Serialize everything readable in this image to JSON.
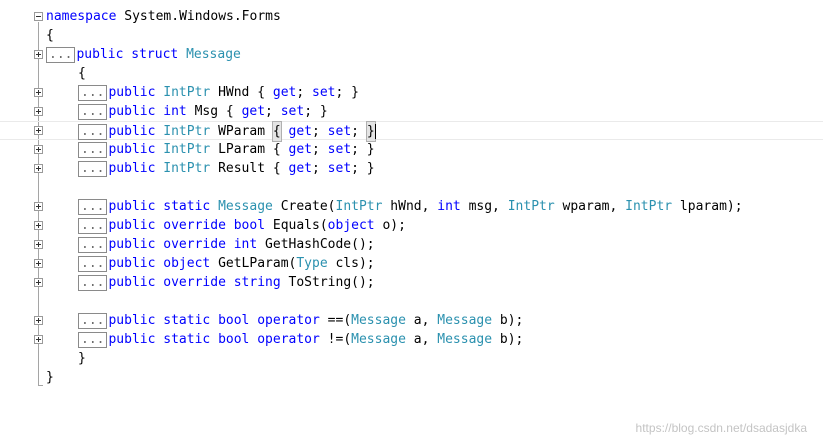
{
  "colors": {
    "keyword": "#0000ff",
    "type": "#2b91af",
    "plain": "#000000",
    "collapsed_marker": "#6d6d6d",
    "watermark": "#c4c4c4"
  },
  "ellipsis_label": "...",
  "watermark": "https://blog.csdn.net/dsadasjdka",
  "lines": [
    {
      "toggle": "expanded",
      "ellipsis": false,
      "current": false,
      "tokens": [
        {
          "t": "namespace",
          "k": "kw"
        },
        {
          "t": " System.Windows.Forms",
          "k": "pl"
        }
      ]
    },
    {
      "toggle": "none",
      "ellipsis": false,
      "current": false,
      "tokens": [
        {
          "t": "{",
          "k": "pl"
        }
      ]
    },
    {
      "toggle": "collapsed",
      "ellipsis": true,
      "current": false,
      "tokens": [
        {
          "t": "public",
          "k": "kw"
        },
        {
          "t": " ",
          "k": "pl"
        },
        {
          "t": "struct",
          "k": "kw"
        },
        {
          "t": " ",
          "k": "pl"
        },
        {
          "t": "Message",
          "k": "ty"
        }
      ]
    },
    {
      "toggle": "none",
      "ellipsis": false,
      "current": false,
      "tokens": [
        {
          "t": "{",
          "k": "pl"
        }
      ]
    },
    {
      "toggle": "collapsed",
      "ellipsis": true,
      "current": false,
      "tokens": [
        {
          "t": "public",
          "k": "kw"
        },
        {
          "t": " ",
          "k": "pl"
        },
        {
          "t": "IntPtr",
          "k": "ty"
        },
        {
          "t": " HWnd { ",
          "k": "pl"
        },
        {
          "t": "get",
          "k": "kw"
        },
        {
          "t": "; ",
          "k": "pl"
        },
        {
          "t": "set",
          "k": "kw"
        },
        {
          "t": "; }",
          "k": "pl"
        }
      ]
    },
    {
      "toggle": "collapsed",
      "ellipsis": true,
      "current": false,
      "tokens": [
        {
          "t": "public",
          "k": "kw"
        },
        {
          "t": " ",
          "k": "pl"
        },
        {
          "t": "int",
          "k": "kw"
        },
        {
          "t": " Msg { ",
          "k": "pl"
        },
        {
          "t": "get",
          "k": "kw"
        },
        {
          "t": "; ",
          "k": "pl"
        },
        {
          "t": "set",
          "k": "kw"
        },
        {
          "t": "; }",
          "k": "pl"
        }
      ]
    },
    {
      "toggle": "collapsed",
      "ellipsis": true,
      "current": true,
      "tokens": [
        {
          "t": "public",
          "k": "kw"
        },
        {
          "t": " ",
          "k": "pl"
        },
        {
          "t": "IntPtr",
          "k": "ty"
        },
        {
          "t": " WParam ",
          "k": "pl"
        },
        {
          "t": "{",
          "k": "hl"
        },
        {
          "t": " ",
          "k": "pl"
        },
        {
          "t": "get",
          "k": "kw"
        },
        {
          "t": "; ",
          "k": "pl"
        },
        {
          "t": "set",
          "k": "kw"
        },
        {
          "t": "; ",
          "k": "pl"
        },
        {
          "t": "}",
          "k": "hl"
        },
        {
          "t": "",
          "k": "caret"
        }
      ]
    },
    {
      "toggle": "collapsed",
      "ellipsis": true,
      "current": false,
      "tokens": [
        {
          "t": "public",
          "k": "kw"
        },
        {
          "t": " ",
          "k": "pl"
        },
        {
          "t": "IntPtr",
          "k": "ty"
        },
        {
          "t": " LParam { ",
          "k": "pl"
        },
        {
          "t": "get",
          "k": "kw"
        },
        {
          "t": "; ",
          "k": "pl"
        },
        {
          "t": "set",
          "k": "kw"
        },
        {
          "t": "; }",
          "k": "pl"
        }
      ]
    },
    {
      "toggle": "collapsed",
      "ellipsis": true,
      "current": false,
      "tokens": [
        {
          "t": "public",
          "k": "kw"
        },
        {
          "t": " ",
          "k": "pl"
        },
        {
          "t": "IntPtr",
          "k": "ty"
        },
        {
          "t": " Result { ",
          "k": "pl"
        },
        {
          "t": "get",
          "k": "kw"
        },
        {
          "t": "; ",
          "k": "pl"
        },
        {
          "t": "set",
          "k": "kw"
        },
        {
          "t": "; }",
          "k": "pl"
        }
      ]
    },
    {
      "toggle": "none",
      "ellipsis": false,
      "current": false,
      "tokens": []
    },
    {
      "toggle": "collapsed",
      "ellipsis": true,
      "current": false,
      "tokens": [
        {
          "t": "public",
          "k": "kw"
        },
        {
          "t": " ",
          "k": "pl"
        },
        {
          "t": "static",
          "k": "kw"
        },
        {
          "t": " ",
          "k": "pl"
        },
        {
          "t": "Message",
          "k": "ty"
        },
        {
          "t": " Create(",
          "k": "pl"
        },
        {
          "t": "IntPtr",
          "k": "ty"
        },
        {
          "t": " hWnd, ",
          "k": "pl"
        },
        {
          "t": "int",
          "k": "kw"
        },
        {
          "t": " msg, ",
          "k": "pl"
        },
        {
          "t": "IntPtr",
          "k": "ty"
        },
        {
          "t": " wparam, ",
          "k": "pl"
        },
        {
          "t": "IntPtr",
          "k": "ty"
        },
        {
          "t": " lparam);",
          "k": "pl"
        }
      ]
    },
    {
      "toggle": "collapsed",
      "ellipsis": true,
      "current": false,
      "tokens": [
        {
          "t": "public",
          "k": "kw"
        },
        {
          "t": " ",
          "k": "pl"
        },
        {
          "t": "override",
          "k": "kw"
        },
        {
          "t": " ",
          "k": "pl"
        },
        {
          "t": "bool",
          "k": "kw"
        },
        {
          "t": " Equals(",
          "k": "pl"
        },
        {
          "t": "object",
          "k": "kw"
        },
        {
          "t": " o);",
          "k": "pl"
        }
      ]
    },
    {
      "toggle": "collapsed",
      "ellipsis": true,
      "current": false,
      "tokens": [
        {
          "t": "public",
          "k": "kw"
        },
        {
          "t": " ",
          "k": "pl"
        },
        {
          "t": "override",
          "k": "kw"
        },
        {
          "t": " ",
          "k": "pl"
        },
        {
          "t": "int",
          "k": "kw"
        },
        {
          "t": " GetHashCode();",
          "k": "pl"
        }
      ]
    },
    {
      "toggle": "collapsed",
      "ellipsis": true,
      "current": false,
      "tokens": [
        {
          "t": "public",
          "k": "kw"
        },
        {
          "t": " ",
          "k": "pl"
        },
        {
          "t": "object",
          "k": "kw"
        },
        {
          "t": " GetLParam(",
          "k": "pl"
        },
        {
          "t": "Type",
          "k": "ty"
        },
        {
          "t": " cls);",
          "k": "pl"
        }
      ]
    },
    {
      "toggle": "collapsed",
      "ellipsis": true,
      "current": false,
      "tokens": [
        {
          "t": "public",
          "k": "kw"
        },
        {
          "t": " ",
          "k": "pl"
        },
        {
          "t": "override",
          "k": "kw"
        },
        {
          "t": " ",
          "k": "pl"
        },
        {
          "t": "string",
          "k": "kw"
        },
        {
          "t": " ToString();",
          "k": "pl"
        }
      ]
    },
    {
      "toggle": "none",
      "ellipsis": false,
      "current": false,
      "tokens": []
    },
    {
      "toggle": "collapsed",
      "ellipsis": true,
      "current": false,
      "tokens": [
        {
          "t": "public",
          "k": "kw"
        },
        {
          "t": " ",
          "k": "pl"
        },
        {
          "t": "static",
          "k": "kw"
        },
        {
          "t": " ",
          "k": "pl"
        },
        {
          "t": "bool",
          "k": "kw"
        },
        {
          "t": " ",
          "k": "pl"
        },
        {
          "t": "operator",
          "k": "kw"
        },
        {
          "t": " ==(",
          "k": "pl"
        },
        {
          "t": "Message",
          "k": "ty"
        },
        {
          "t": " a, ",
          "k": "pl"
        },
        {
          "t": "Message",
          "k": "ty"
        },
        {
          "t": " b);",
          "k": "pl"
        }
      ]
    },
    {
      "toggle": "collapsed",
      "ellipsis": true,
      "current": false,
      "tokens": [
        {
          "t": "public",
          "k": "kw"
        },
        {
          "t": " ",
          "k": "pl"
        },
        {
          "t": "static",
          "k": "kw"
        },
        {
          "t": " ",
          "k": "pl"
        },
        {
          "t": "bool",
          "k": "kw"
        },
        {
          "t": " ",
          "k": "pl"
        },
        {
          "t": "operator",
          "k": "kw"
        },
        {
          "t": " !=(",
          "k": "pl"
        },
        {
          "t": "Message",
          "k": "ty"
        },
        {
          "t": " a, ",
          "k": "pl"
        },
        {
          "t": "Message",
          "k": "ty"
        },
        {
          "t": " b);",
          "k": "pl"
        }
      ]
    },
    {
      "toggle": "none",
      "ellipsis": false,
      "current": false,
      "tokens": [
        {
          "t": "}",
          "k": "pl"
        }
      ]
    },
    {
      "toggle": "none",
      "ellipsis": false,
      "current": false,
      "tokens": [
        {
          "t": "}",
          "k": "pl"
        }
      ]
    }
  ]
}
